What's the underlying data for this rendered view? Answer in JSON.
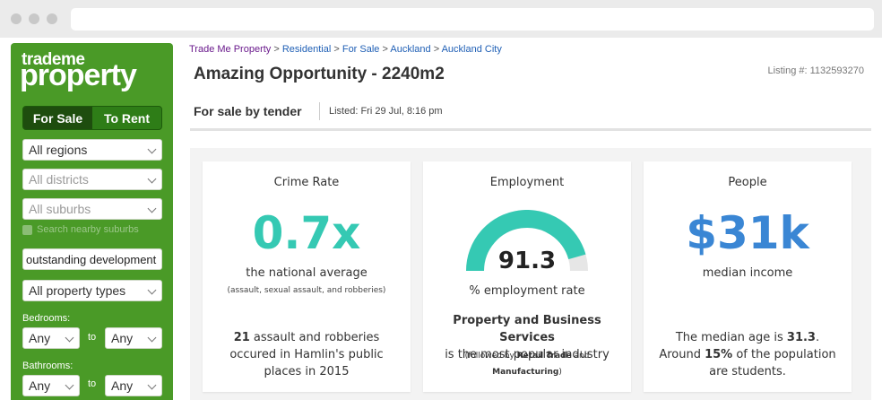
{
  "sidebar": {
    "logo_top": "trademe",
    "logo_bottom": "property",
    "tabs": [
      {
        "label": "For Sale",
        "active": true
      },
      {
        "label": "To Rent",
        "active": false
      }
    ],
    "regions": "All regions",
    "districts": "All districts",
    "suburbs": "All suburbs",
    "nearby_label": "Search nearby suburbs",
    "keyword_value": "outstanding development",
    "property_types": "All property types",
    "bedrooms_label": "Bedrooms:",
    "bedrooms_min": "Any",
    "bedrooms_max": "Any",
    "bathrooms_label": "Bathrooms:",
    "bathrooms_min": "Any",
    "bathrooms_max": "Any",
    "to_label": "to"
  },
  "breadcrumb": {
    "items": [
      "Trade Me Property",
      "Residential",
      "For Sale",
      "Auckland",
      "Auckland City"
    ],
    "separator": ">"
  },
  "listing": {
    "title": "Amazing Opportunity - 2240m2",
    "number": "Listing #: 1132593270",
    "sale_type": "For sale by tender",
    "listed": "Listed: Fri 29 Jul, 8:16 pm"
  },
  "cards": {
    "crime": {
      "title": "Crime Rate",
      "value": "0.7x",
      "sub": "the national average",
      "note": "(assault, sexual assault, and robberies)",
      "desc_bold": "21",
      "desc_rest": " assault and robberies occured in Hamlin's public places in 2015"
    },
    "employment": {
      "title": "Employment",
      "value": "91.3",
      "gauge_fraction": 0.913,
      "sub": "% employment rate",
      "industry": "Property and Business Services",
      "industry_rest": "is the most popular industry",
      "followed_prefix": "(followed by ",
      "followed_1": "Retail Trade",
      "followed_and": " and ",
      "followed_2": "Manufacturing",
      "followed_suffix": ")"
    },
    "people": {
      "title": "People",
      "value": "$31k",
      "sub": "median income",
      "desc_pre": "The median age is ",
      "desc_age": "31.3",
      "desc_mid": ". Around ",
      "desc_pct": "15%",
      "desc_post": " of the population are students."
    }
  },
  "colors": {
    "sidebar_green": "#4a9a27",
    "teal": "#35c9b3",
    "blue": "#3a86d4",
    "gauge_track": "#e6e6e6"
  }
}
